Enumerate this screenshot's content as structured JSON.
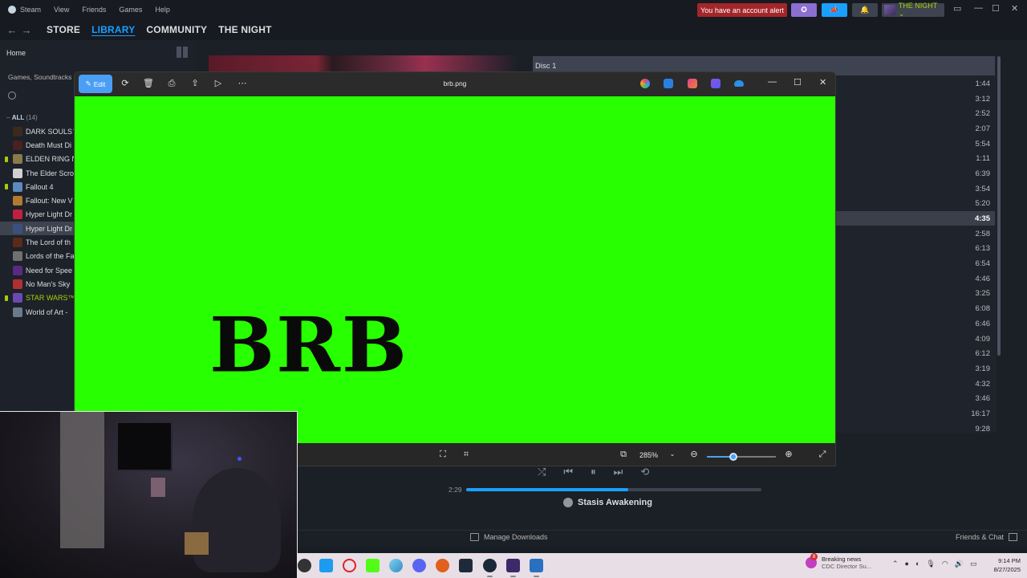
{
  "steam": {
    "app_name": "Steam",
    "menu": [
      "View",
      "Friends",
      "Games",
      "Help"
    ],
    "alert_label": "You have an account alert",
    "username": "THE NIGHT ⌄",
    "nav_tabs": [
      "STORE",
      "LIBRARY",
      "COMMUNITY",
      "THE NIGHT"
    ],
    "active_tab": "LIBRARY",
    "sidebar": {
      "home_label": "Home",
      "filter_label": "Games, Soundtracks",
      "all_label": "ALL",
      "all_count": "(14)",
      "games": [
        {
          "name": "DARK SOULS™",
          "color": "#3b2a1c",
          "dl": false
        },
        {
          "name": "Death Must Di",
          "color": "#4a2020",
          "dl": false
        },
        {
          "name": "ELDEN RING N",
          "color": "#8a7a4a",
          "dl": true
        },
        {
          "name": "The Elder Scro",
          "color": "#d0d0d0",
          "dl": false
        },
        {
          "name": "Fallout 4",
          "color": "#5a8ac0",
          "dl": true
        },
        {
          "name": "Fallout: New V",
          "color": "#b07a30",
          "dl": false
        },
        {
          "name": "Hyper Light Dr",
          "color": "#c02040",
          "dl": false
        },
        {
          "name": "Hyper Light Dr",
          "color": "#3a5080",
          "dl": false,
          "selected": true
        },
        {
          "name": "The Lord of th",
          "color": "#5a2a1a",
          "dl": false
        },
        {
          "name": "Lords of the Fa",
          "color": "#707070",
          "dl": false
        },
        {
          "name": "Need for Spee",
          "color": "#5a2a80",
          "dl": false
        },
        {
          "name": "No Man's Sky",
          "color": "#b03030",
          "dl": false
        },
        {
          "name": "STAR WARS™",
          "color": "#6a4ab0",
          "dl": true,
          "green": true
        },
        {
          "name": "World of Art -",
          "color": "#6a7a8a",
          "dl": false
        }
      ]
    },
    "soundtrack": {
      "disc_label": "Disc 1",
      "track_times": [
        "1:44",
        "3:12",
        "2:52",
        "2:07",
        "5:54",
        "1:11",
        "6:39",
        "3:54",
        "5:20",
        "4:35",
        "2:58",
        "6:13",
        "6:54",
        "4:46",
        "3:25",
        "6:08",
        "6:46",
        "4:09",
        "6:12",
        "3:19",
        "4:32",
        "3:46",
        "16:17",
        "9:28"
      ],
      "active_index": 9,
      "elapsed": "2:29",
      "progress": 0.55,
      "now_playing": "Stasis Awakening"
    },
    "bottom": {
      "manage_downloads": "Manage Downloads",
      "friends_chat": "Friends & Chat"
    }
  },
  "viewer": {
    "edit_label": "Edit",
    "filename": "brb.png",
    "image_text": "BRB",
    "zoom_label": "285%",
    "zoom_level": 0.38,
    "colors": {
      "canvas": "#28ff00",
      "accent": "#4a9ff5"
    }
  },
  "taskbar": {
    "news_title": "Breaking news",
    "news_sub": "CDC Director Su...",
    "news_badge": "8",
    "time": "9:14 PM",
    "date": "8/27/2025"
  }
}
